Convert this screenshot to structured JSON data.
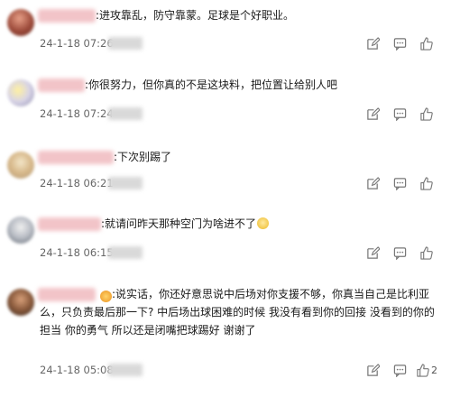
{
  "comments": [
    {
      "content": ":进攻靠乱，防守靠蒙。足球是个好职业。",
      "timestamp": "24-1-18 07:26",
      "likes": ""
    },
    {
      "content": ":你很努力，但你真的不是这块料，把位置让给别人吧",
      "timestamp": "24-1-18 07:24",
      "likes": ""
    },
    {
      "content": ":下次别踢了",
      "timestamp": "24-1-18 06:21",
      "likes": ""
    },
    {
      "content": ":就请问昨天那种空门为啥进不了",
      "timestamp": "24-1-18 06:15",
      "likes": ""
    },
    {
      "content": ":说实话，你还好意思说中后场对你支援不够，你真当自己是比利亚么，只负责最后那一下? 中后场出球困难的时候 我没有看到你的回接 没看到的你的担当 你的勇气 所以还是闭嘴把球踢好 谢谢了",
      "timestamp": "24-1-18 05:08",
      "likes": "2"
    }
  ],
  "icons": {
    "edit": "edit-icon",
    "comment": "comment-icon",
    "like": "thumbs-up-icon"
  },
  "colors": {
    "name_blur": "#f2c4c8",
    "timestamp": "#666666"
  }
}
